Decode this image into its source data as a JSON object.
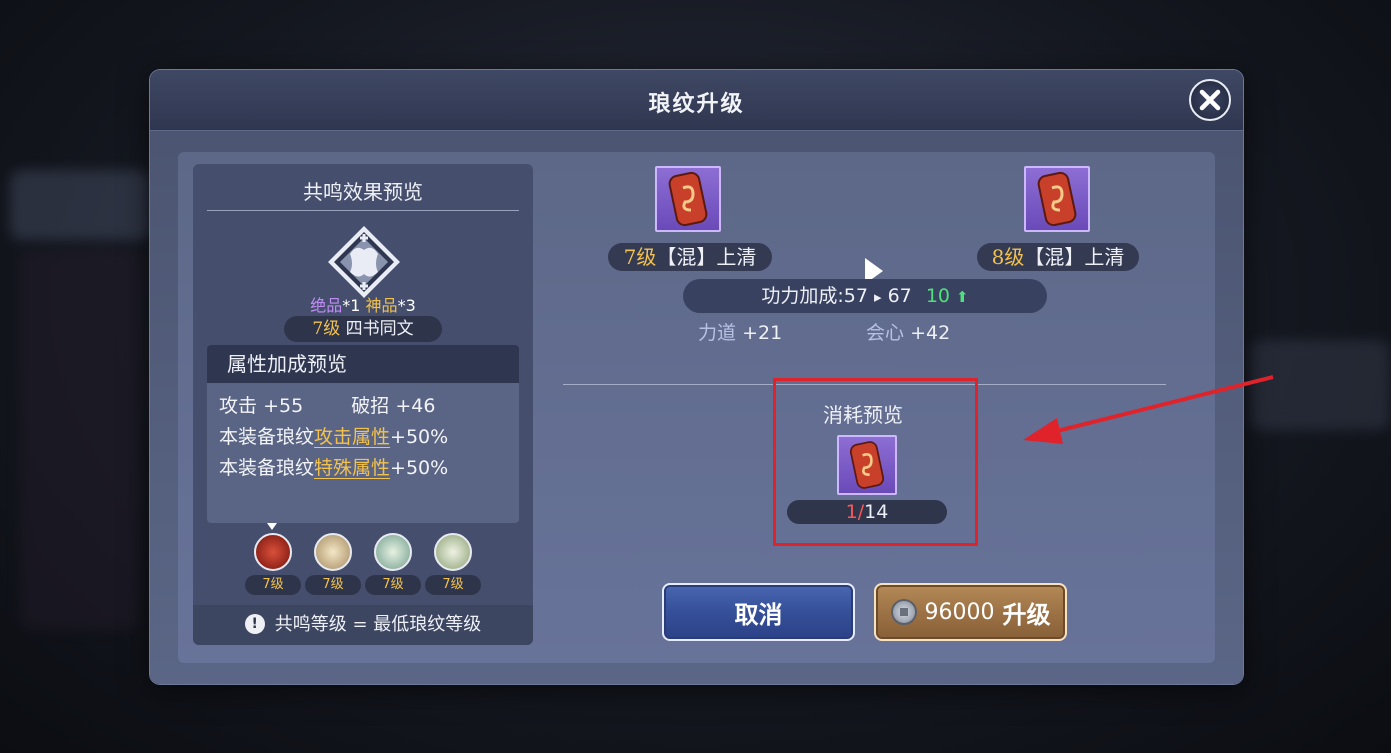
{
  "dialog": {
    "title": "琅纹升级"
  },
  "resonance": {
    "title": "共鸣效果预览",
    "grade_jue_label": "绝品",
    "grade_jue_count": "*1",
    "grade_shen_label": "神品",
    "grade_shen_count": "*3",
    "level_num": "7级",
    "level_name": "四书同文",
    "attr_title": "属性加成预览",
    "attr_attack_label": "攻击",
    "attr_attack_value": "+55",
    "attr_break_label": "破招",
    "attr_break_value": "+46",
    "line2_prefix": "本装备琅纹",
    "line2_highlight": "攻击属性",
    "line2_value": "+50%",
    "line3_prefix": "本装备琅纹",
    "line3_highlight": "特殊属性",
    "line3_value": "+50%",
    "pips": [
      "7级",
      "7级",
      "7级",
      "7级"
    ],
    "footnote": "共鸣等级 = 最低琅纹等级",
    "footnote_icon": "!"
  },
  "upgrade": {
    "from_level": "7级",
    "from_name": "【混】上清",
    "to_level": "8级",
    "to_name": "【混】上清",
    "power_label": "功力加成:57",
    "power_arrow": "▸",
    "power_to": "67",
    "power_gain": "10",
    "power_gain_icon": "⬆",
    "stat1_label": "力道",
    "stat1_value": "+21",
    "stat2_label": "会心",
    "stat2_value": "+42"
  },
  "cost": {
    "title": "消耗预览",
    "have": "1",
    "sep": "/",
    "need": "14"
  },
  "buttons": {
    "cancel": "取消",
    "upgrade_price": "96000",
    "upgrade": "升级"
  },
  "colors": {
    "gold": "#f2c14e",
    "purple": "#c08cf4",
    "green": "#4fe07a",
    "red": "#e0222a"
  }
}
